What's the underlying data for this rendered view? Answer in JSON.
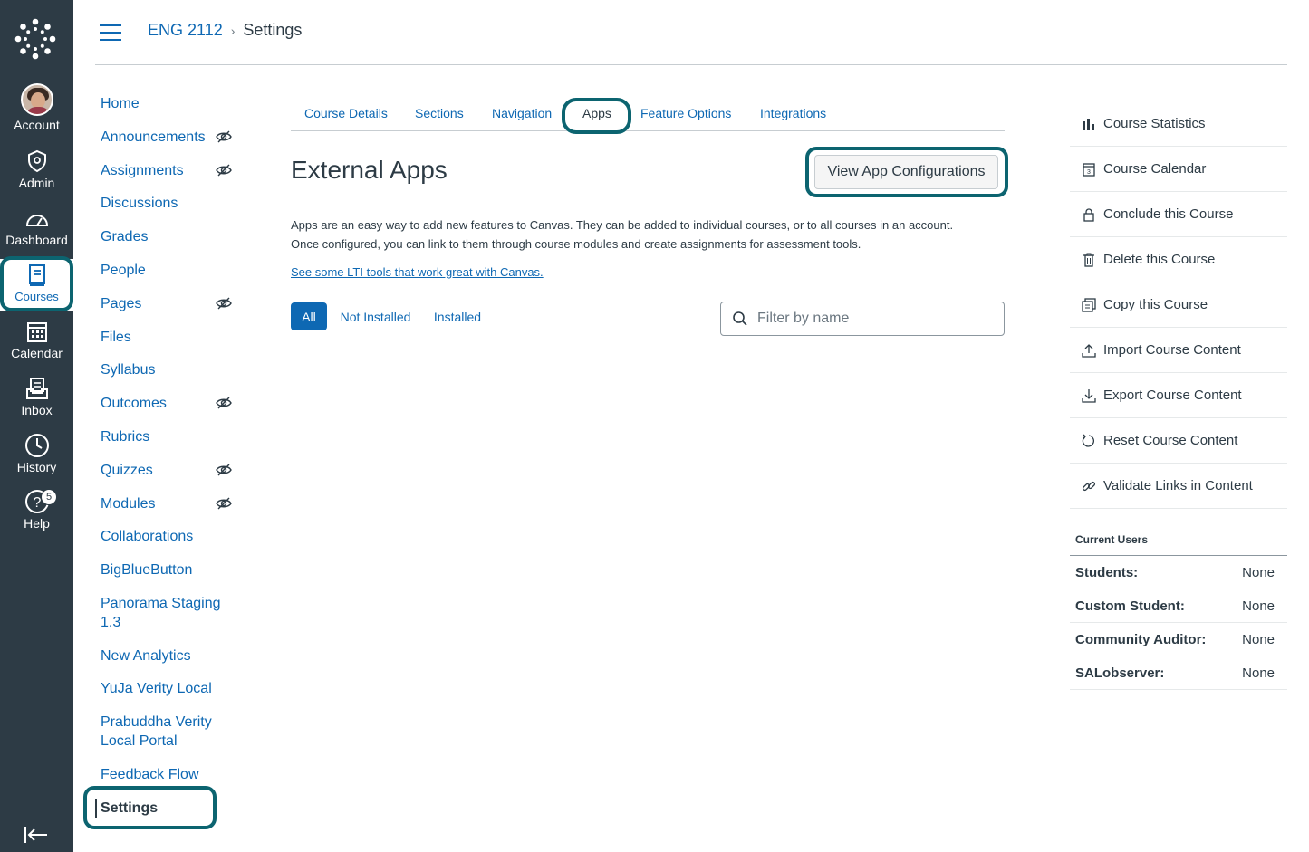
{
  "global_nav": {
    "items": [
      {
        "label": "Account",
        "icon": "avatar"
      },
      {
        "label": "Admin",
        "icon": "shield-icon"
      },
      {
        "label": "Dashboard",
        "icon": "dashboard-icon"
      },
      {
        "label": "Courses",
        "icon": "book-icon"
      },
      {
        "label": "Calendar",
        "icon": "calendar-icon"
      },
      {
        "label": "Inbox",
        "icon": "inbox-icon"
      },
      {
        "label": "History",
        "icon": "clock-icon"
      },
      {
        "label": "Help",
        "icon": "help-icon"
      }
    ],
    "help_badge": "5"
  },
  "header": {
    "course": "ENG 2112",
    "separator": "›",
    "current": "Settings"
  },
  "course_nav": {
    "items": [
      {
        "label": "Home",
        "hidden": false
      },
      {
        "label": "Announcements",
        "hidden": true
      },
      {
        "label": "Assignments",
        "hidden": true
      },
      {
        "label": "Discussions",
        "hidden": false
      },
      {
        "label": "Grades",
        "hidden": false
      },
      {
        "label": "People",
        "hidden": false
      },
      {
        "label": "Pages",
        "hidden": true
      },
      {
        "label": "Files",
        "hidden": false
      },
      {
        "label": "Syllabus",
        "hidden": false
      },
      {
        "label": "Outcomes",
        "hidden": true
      },
      {
        "label": "Rubrics",
        "hidden": false
      },
      {
        "label": "Quizzes",
        "hidden": true
      },
      {
        "label": "Modules",
        "hidden": true
      },
      {
        "label": "Collaborations",
        "hidden": false
      },
      {
        "label": "BigBlueButton",
        "hidden": false
      },
      {
        "label": "Panorama Staging 1.3",
        "hidden": false
      },
      {
        "label": "New Analytics",
        "hidden": false
      },
      {
        "label": "YuJa Verity Local",
        "hidden": false
      },
      {
        "label": "Prabuddha Verity Local Portal",
        "hidden": false
      },
      {
        "label": "Feedback Flow",
        "hidden": false
      },
      {
        "label": "Settings",
        "hidden": false
      }
    ]
  },
  "tabs": [
    "Course Details",
    "Sections",
    "Navigation",
    "Apps",
    "Feature Options",
    "Integrations"
  ],
  "main": {
    "title": "External Apps",
    "config_button": "View App Configurations",
    "description_line1": "Apps are an easy way to add new features to Canvas. They can be added to individual courses, or to all courses in an account.",
    "description_line2": "Once configured, you can link to them through course modules and create assignments for assessment tools.",
    "lti_link": "See some LTI tools that work great with Canvas.",
    "filters": [
      "All",
      "Not Installed",
      "Installed"
    ],
    "search_placeholder": "Filter by name"
  },
  "right_sidebar": {
    "actions": [
      {
        "label": "Course Statistics",
        "icon": "bar-chart-icon"
      },
      {
        "label": "Course Calendar",
        "icon": "calendar-icon"
      },
      {
        "label": "Conclude this Course",
        "icon": "lock-icon"
      },
      {
        "label": "Delete this Course",
        "icon": "trash-icon"
      },
      {
        "label": "Copy this Course",
        "icon": "copy-icon"
      },
      {
        "label": "Import Course Content",
        "icon": "upload-icon"
      },
      {
        "label": "Export Course Content",
        "icon": "download-icon"
      },
      {
        "label": "Reset Course Content",
        "icon": "reset-icon"
      },
      {
        "label": "Validate Links in Content",
        "icon": "link-icon"
      }
    ],
    "current_users_title": "Current Users",
    "users": [
      {
        "label": "Students:",
        "value": "None"
      },
      {
        "label": "Custom Student:",
        "value": "None"
      },
      {
        "label": "Community Auditor:",
        "value": "None"
      },
      {
        "label": "SALobserver:",
        "value": "None"
      }
    ]
  },
  "colors": {
    "nav_bg": "#2d3b45",
    "link": "#0e68b3",
    "highlight": "#0c6470"
  }
}
